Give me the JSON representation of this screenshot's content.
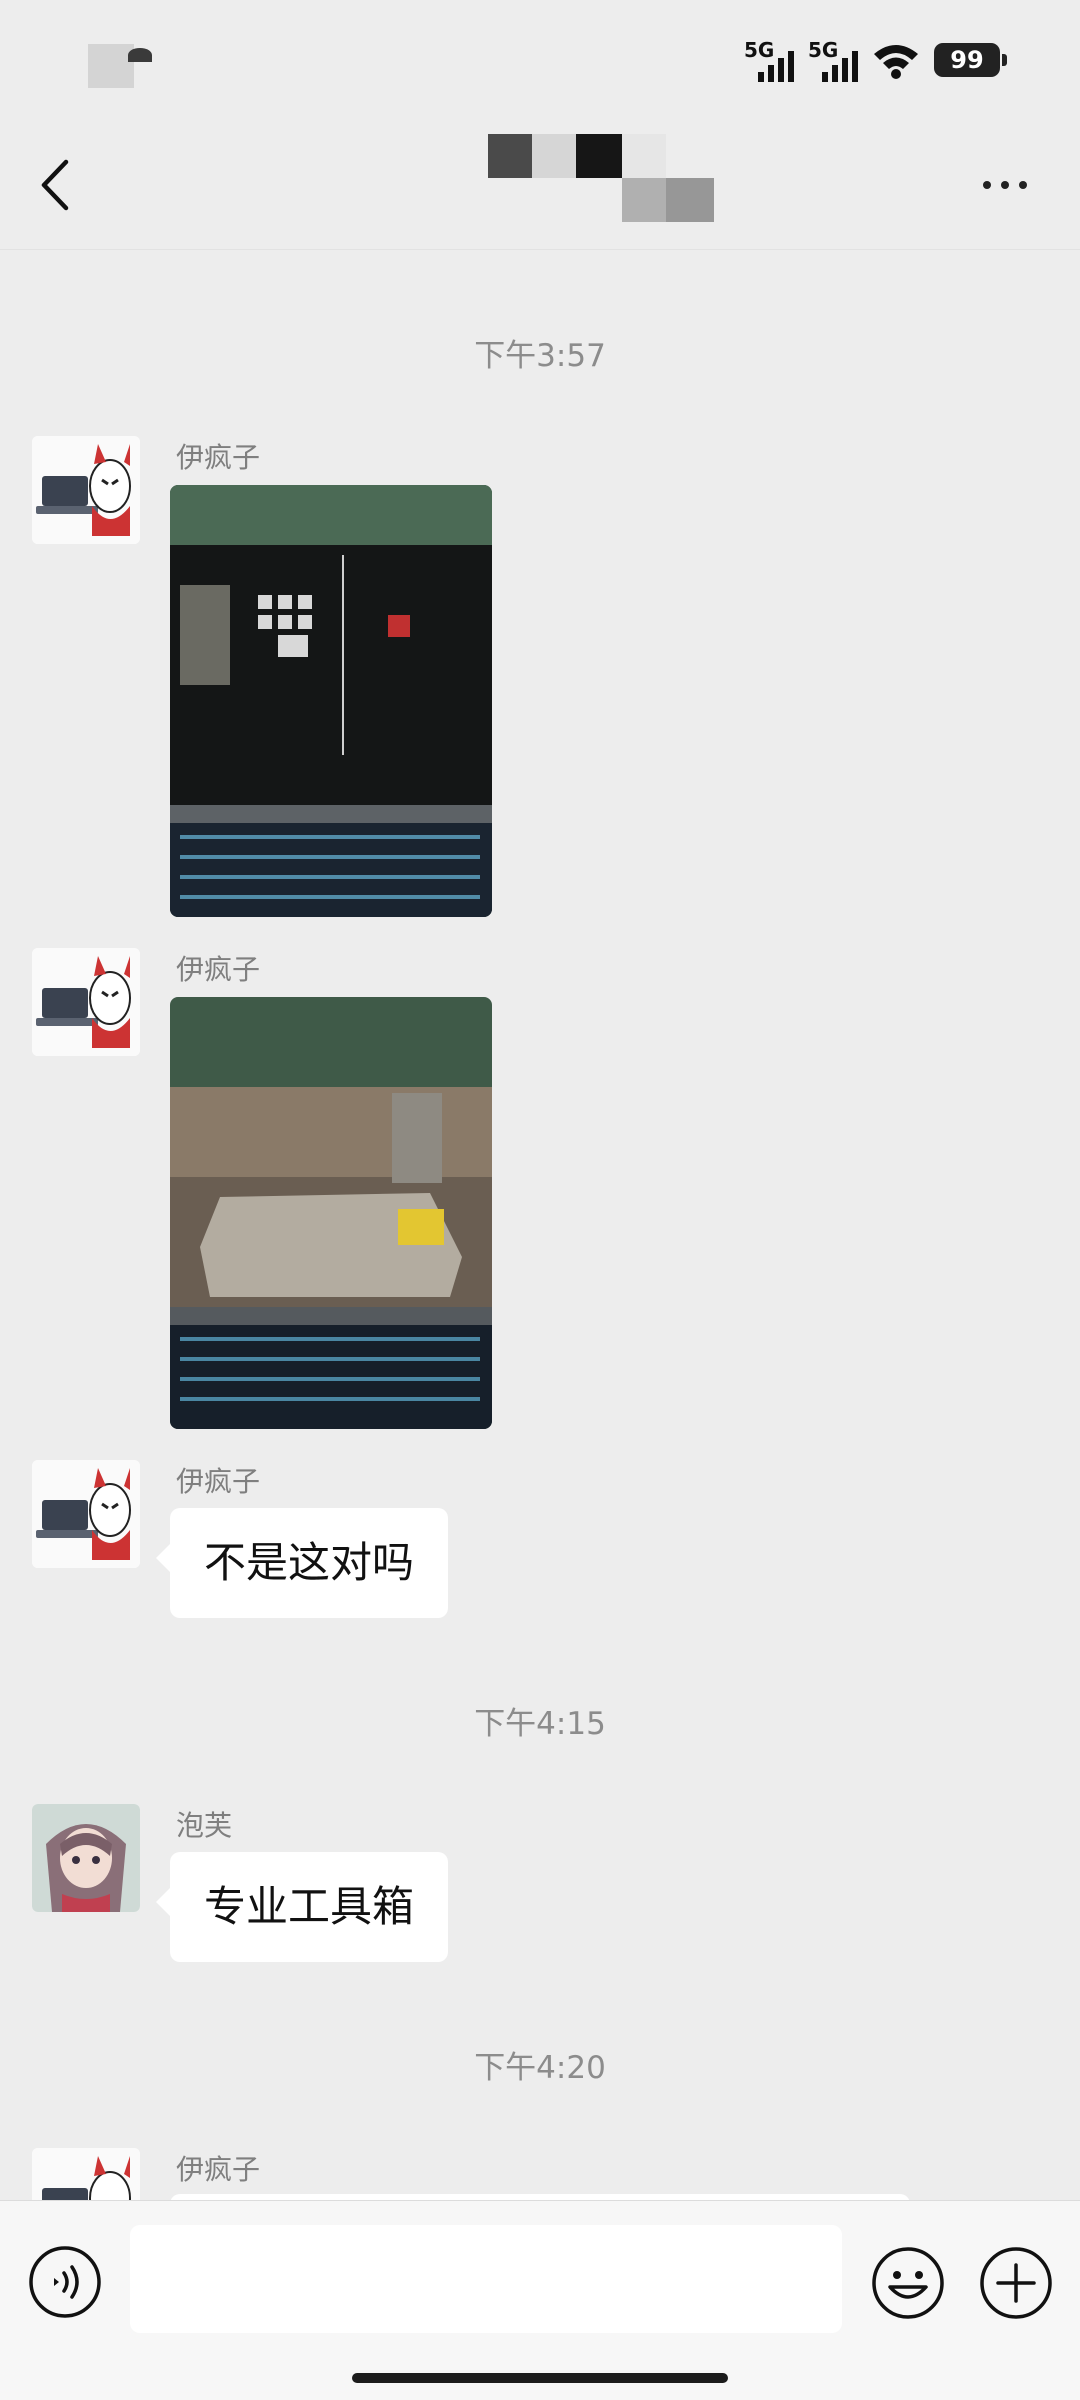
{
  "status_bar": {
    "sim1_label": "5G",
    "sim2_label": "5G",
    "wifi_icon": "wifi-icon",
    "battery_level": "99"
  },
  "header": {
    "back_icon": "chevron-left-icon",
    "title_redacted": true,
    "more_icon": "more-dots-icon"
  },
  "messages": [
    {
      "type": "timestamp",
      "text": "下午3:57"
    },
    {
      "type": "image",
      "sender": "伊疯子",
      "avatar": "laptop-mask-avatar",
      "image": "photo-of-laptop-inventory-screen"
    },
    {
      "type": "image",
      "sender": "伊疯子",
      "avatar": "laptop-mask-avatar",
      "image": "photo-of-laptop-game-crate"
    },
    {
      "type": "text",
      "sender": "伊疯子",
      "avatar": "laptop-mask-avatar",
      "text": "不是这对吗"
    },
    {
      "type": "timestamp",
      "text": "下午4:15"
    },
    {
      "type": "text",
      "sender": "泡芙",
      "avatar": "anime-girl-avatar",
      "text": "专业工具箱"
    },
    {
      "type": "timestamp",
      "text": "下午4:20"
    },
    {
      "type": "partial",
      "sender": "伊疯子",
      "avatar": "laptop-mask-avatar"
    }
  ],
  "input_bar": {
    "voice_icon": "voice-icon",
    "input_value": "",
    "emoji_icon": "emoji-icon",
    "plus_icon": "plus-icon"
  },
  "colors": {
    "background": "#ededed",
    "bubble": "#ffffff",
    "timestamp": "#8c8c8c",
    "sender_name": "#7f7f7f"
  }
}
